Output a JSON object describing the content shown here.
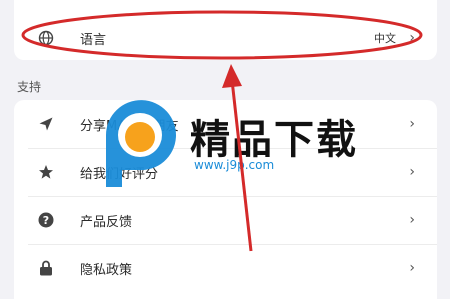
{
  "language_row": {
    "label": "语言",
    "value": "中文",
    "icon": "globe-icon"
  },
  "support": {
    "title": "支持",
    "items": [
      {
        "label": "分享MAIN到朋友",
        "icon": "share-icon"
      },
      {
        "label": "给我们好评分",
        "icon": "star-icon"
      },
      {
        "label": "产品反馈",
        "icon": "question-icon"
      },
      {
        "label": "隐私政策",
        "icon": "lock-icon"
      }
    ]
  },
  "watermark": {
    "text": "精品下载",
    "url": "www.j9p.com"
  },
  "colors": {
    "annotation": "#d42a2a",
    "watermark_blue": "#1a8cd8",
    "watermark_orange": "#f7a21c"
  }
}
